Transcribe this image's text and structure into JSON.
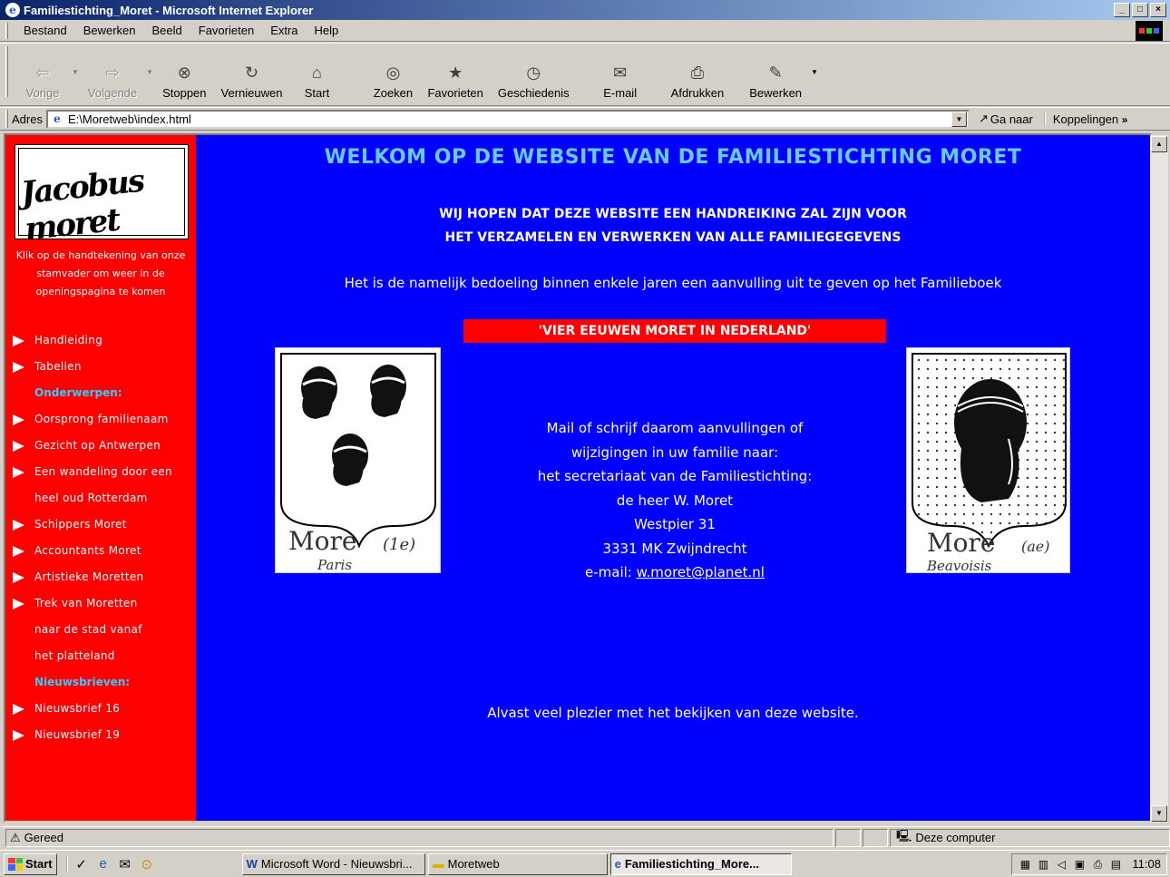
{
  "window": {
    "title": "Familiestichting_Moret - Microsoft Internet Explorer",
    "buttons": [
      "_",
      "□",
      "×"
    ]
  },
  "menu": [
    "Bestand",
    "Bewerken",
    "Beeld",
    "Favorieten",
    "Extra",
    "Help"
  ],
  "toolbar": {
    "back": "Vorige",
    "forward": "Volgende",
    "stop": "Stoppen",
    "refresh": "Vernieuwen",
    "home": "Start",
    "search": "Zoeken",
    "favorites": "Favorieten",
    "history": "Geschiedenis",
    "mail": "E-mail",
    "print": "Afdrukken",
    "edit": "Bewerken"
  },
  "address": {
    "label": "Adres",
    "value": "E:\\Moretweb\\index.html",
    "go": "Ga naar",
    "links": "Koppelingen"
  },
  "sidebar": {
    "signature": "Jacobus moret",
    "note": "Klik op de handtekening van onze stamvader om weer in de openingspagina te komen",
    "nav": [
      {
        "type": "link",
        "lines": [
          "Handleiding"
        ]
      },
      {
        "type": "link",
        "lines": [
          "Tabellen"
        ]
      },
      {
        "type": "heading",
        "lines": [
          "Onderwerpen:"
        ]
      },
      {
        "type": "link",
        "lines": [
          "Oorsprong familienaam"
        ]
      },
      {
        "type": "link",
        "lines": [
          "Gezicht op Antwerpen"
        ]
      },
      {
        "type": "link",
        "lines": [
          "Een wandeling door een",
          "heel oud Rotterdam"
        ]
      },
      {
        "type": "link",
        "lines": [
          "Schippers Moret"
        ]
      },
      {
        "type": "link",
        "lines": [
          "Accountants Moret"
        ]
      },
      {
        "type": "link",
        "lines": [
          "Artistieke Moretten"
        ]
      },
      {
        "type": "link",
        "lines": [
          "Trek van Moretten",
          "naar de stad vanaf",
          "het platteland"
        ]
      },
      {
        "type": "heading",
        "lines": [
          "Nieuwsbrieven:"
        ]
      },
      {
        "type": "link",
        "lines": [
          "Nieuwsbrief 16"
        ]
      },
      {
        "type": "link",
        "lines": [
          "Nieuwsbrief 19"
        ]
      }
    ]
  },
  "main": {
    "heading": "WELKOM OP DE WEBSITE VAN DE FAMILIESTICHTING MORET",
    "subheading_1": "WIJ HOPEN DAT DEZE WEBSITE EEN HANDREIKING ZAL ZIJN VOOR",
    "subheading_2": "HET VERZAMELEN EN VERWERKEN VAN ALLE FAMILIEGEGEVENS",
    "intro": "Het is de namelijk bedoeling binnen enkele jaren een aanvulling uit te geven op het Familieboek",
    "book_title": "'VIER EEUWEN MORET IN NEDERLAND'",
    "crest_left": {
      "name": "More",
      "note": "(1e)",
      "place": "Paris"
    },
    "crest_right": {
      "name": "More",
      "note": "(ae)",
      "place": "Beavoisis"
    },
    "contact": {
      "line1": "Mail of schrijf daarom aanvullingen of",
      "line2": "wijzigingen in uw familie naar:",
      "line3": "het secretariaat van de Familiestichting:",
      "line4": "de heer W. Moret",
      "line5": "Westpier 31",
      "line6": "3331 MK Zwijndrecht",
      "email_label": "e-mail:",
      "email": "w.moret@planet.nl"
    },
    "closing": "Alvast veel plezier met het bekijken van deze website."
  },
  "status": {
    "text": "Gereed",
    "zone": "Deze computer"
  },
  "taskbar": {
    "start": "Start",
    "tasks": [
      "Microsoft Word - Nieuwsbri...",
      "Moretweb",
      "Familiestichting_More..."
    ],
    "clock": "11:08"
  },
  "colors": {
    "page_bg": "#0000ff",
    "sidebar_bg": "#ff0000",
    "heading": "#66ccff",
    "nav_heading": "#33ccff"
  }
}
